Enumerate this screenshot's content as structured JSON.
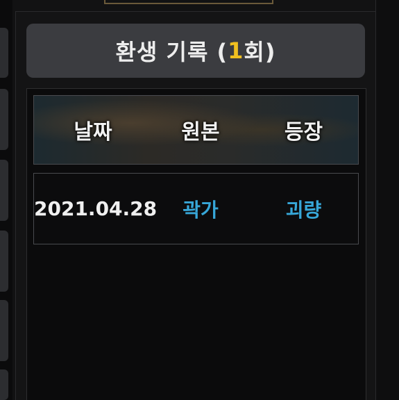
{
  "panel": {
    "title_prefix": "환생 기록 (",
    "title_count": "1",
    "title_suffix": "회)"
  },
  "table": {
    "headers": [
      "날짜",
      "원본",
      "등장"
    ],
    "rows": [
      {
        "date": "2021.04.28",
        "original": "곽가",
        "appearance": "괴량"
      }
    ]
  },
  "colors": {
    "accent_count": "#f0c020",
    "link_blue": "#37a7d8"
  }
}
